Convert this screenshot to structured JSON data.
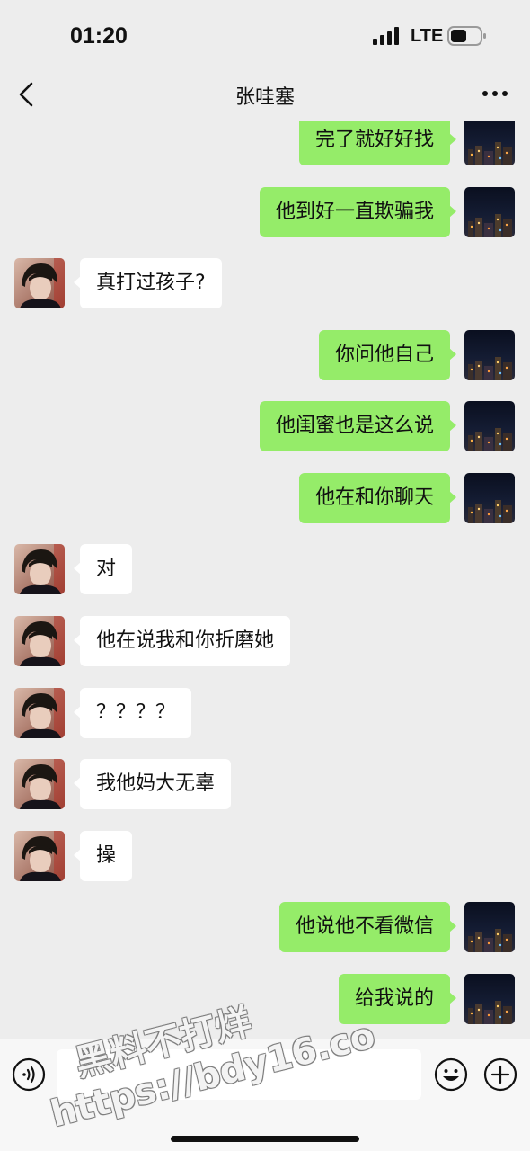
{
  "status_bar": {
    "time": "01:20",
    "network": "LTE"
  },
  "header": {
    "title": "张哇塞",
    "back_icon": "chevron-left-icon",
    "more_icon": "ellipsis-icon"
  },
  "messages": [
    {
      "side": "sent",
      "text": "完了就好好找"
    },
    {
      "side": "sent",
      "text": "他到好一直欺骗我"
    },
    {
      "side": "received",
      "text": "真打过孩子?"
    },
    {
      "side": "sent",
      "text": "你问他自己"
    },
    {
      "side": "sent",
      "text": "他闺蜜也是这么说"
    },
    {
      "side": "sent",
      "text": "他在和你聊天"
    },
    {
      "side": "received",
      "text": "对"
    },
    {
      "side": "received",
      "text": "他在说我和你折磨她"
    },
    {
      "side": "received",
      "text": "？？？？"
    },
    {
      "side": "received",
      "text": "我他妈大无辜"
    },
    {
      "side": "received",
      "text": "操"
    },
    {
      "side": "sent",
      "text": "他说他不看微信"
    },
    {
      "side": "sent",
      "text": "给我说的"
    }
  ],
  "input_bar": {
    "voice_icon": "voice-icon",
    "emoji_icon": "emoji-icon",
    "plus_icon": "plus-icon"
  },
  "watermark": {
    "line1": "黑料不打烊",
    "line2": "https://bdy16.co"
  },
  "colors": {
    "background": "#ededed",
    "sent_bubble": "#95ec69",
    "received_bubble": "#ffffff"
  }
}
